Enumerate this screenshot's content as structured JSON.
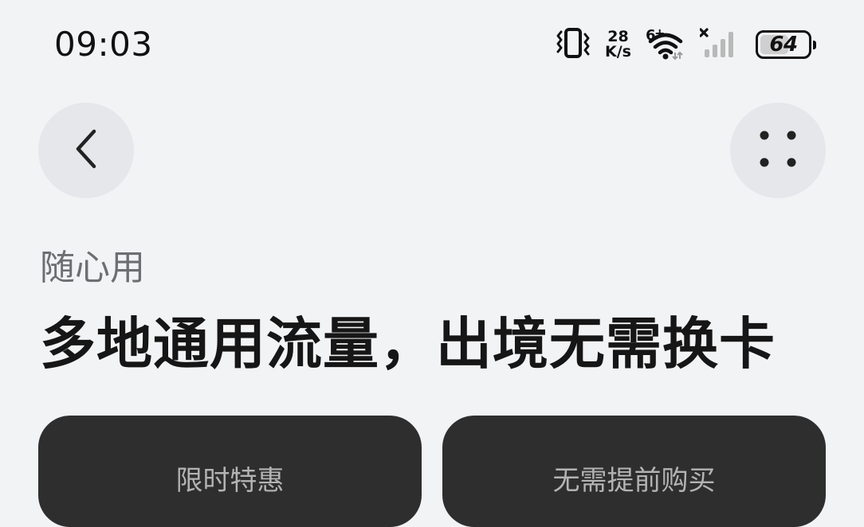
{
  "status_bar": {
    "time": "09:03",
    "network_speed_value": "28",
    "network_speed_unit": "K/s",
    "wifi_tag": "6",
    "battery_level": "64",
    "icons": [
      "vibrate-icon",
      "wifi-icon",
      "signal-icon",
      "battery-icon"
    ]
  },
  "nav": {
    "back_icon": "chevron-left-icon",
    "more_icon": "four-dots-icon"
  },
  "main": {
    "eyebrow": "随心用",
    "headline": "多地通用流量，出境无需换卡"
  },
  "cards": [
    {
      "label": "限时特惠"
    },
    {
      "label": "无需提前购买"
    }
  ],
  "colors": {
    "background": "#f2f3f5",
    "card": "#2e2e2e",
    "card_text": "#b3b3b3",
    "button_bg": "#e6e7ea"
  }
}
